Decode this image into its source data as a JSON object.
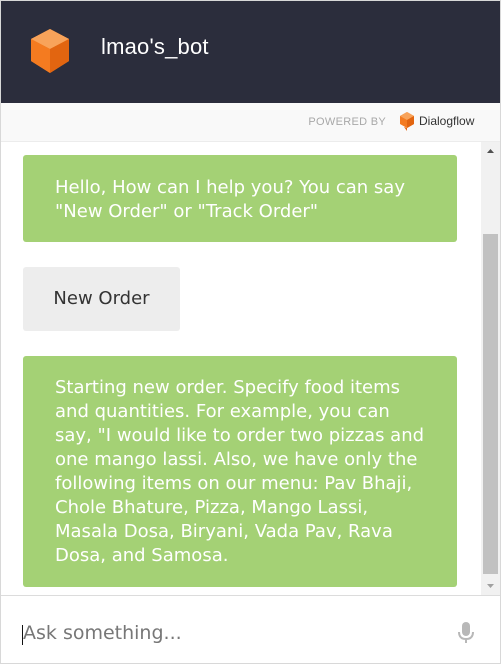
{
  "header": {
    "title": "lmao's_bot",
    "accent_color": "#f47b20",
    "background_color": "#2b2d3c"
  },
  "powered_by": {
    "label": "POWERED BY",
    "brand": "Dialogflow"
  },
  "messages": [
    {
      "sender": "bot",
      "text": "Hello, How can I help you? You can say \"New Order\" or \"Track Order\""
    },
    {
      "sender": "user",
      "text": "New Order"
    },
    {
      "sender": "bot",
      "text": "Starting new order. Specify food items and quantities. For example, you can say, \"I would like to order two pizzas and one mango lassi. Also, we have only the following items on our menu: Pav Bhaji, Chole Bhature, Pizza, Mango Lassi, Masala Dosa, Biryani, Vada Pav, Rava Dosa, and Samosa."
    }
  ],
  "composer": {
    "placeholder": "Ask something...",
    "value": ""
  },
  "colors": {
    "bot_bubble": "#a4d175",
    "user_bubble": "#ededed"
  },
  "icons": {
    "bot_logo": "orange-cube-icon",
    "dialogflow_logo": "dialogflow-icon",
    "mic": "microphone-icon"
  }
}
